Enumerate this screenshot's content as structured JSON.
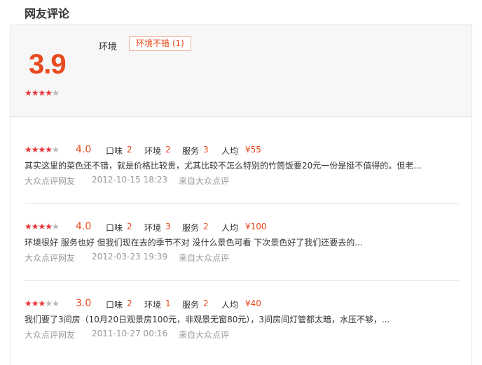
{
  "section": {
    "title": "网友评论"
  },
  "summary": {
    "avg_score": "3.9",
    "avg_stars": 4,
    "tag_category": "环境",
    "tag_chip": "环境不错 (1)"
  },
  "labels": {
    "taste": "口味",
    "env": "环境",
    "service": "服务",
    "avg_price": "人均"
  },
  "colors": {
    "accent": "#e8491d",
    "star_on": "#e8323a",
    "star_off": "#b8b8b8"
  },
  "reviews": [
    {
      "stars": 4,
      "score": "4.0",
      "taste": "2",
      "env": "2",
      "service": "3",
      "avg_price": "¥55",
      "text": "其实这里的菜色还不错，就是价格比较贵，尤其比较不怎么特别的竹筒饭要20元一份是挺不值得的。但老...",
      "author": "大众点评网友",
      "time": "2012-10-15 18:23",
      "source": "来自大众点评"
    },
    {
      "stars": 4,
      "score": "4.0",
      "taste": "2",
      "env": "3",
      "service": "2",
      "avg_price": "¥100",
      "text": "环境很好 服务也好 但我们现在去的季节不对 没什么景色可看 下次景色好了我们还要去的...",
      "author": "大众点评网友",
      "time": "2012-03-23 19:39",
      "source": "来自大众点评"
    },
    {
      "stars": 3,
      "score": "3.0",
      "taste": "2",
      "env": "1",
      "service": "2",
      "avg_price": "¥40",
      "text": "我们要了3间房（10月20日观景房100元，非观景无窗80元），3间房间灯管都太暗，水压不够，...",
      "author": "大众点评网友",
      "time": "2011-10-27 00:16",
      "source": "来自大众点评"
    }
  ]
}
